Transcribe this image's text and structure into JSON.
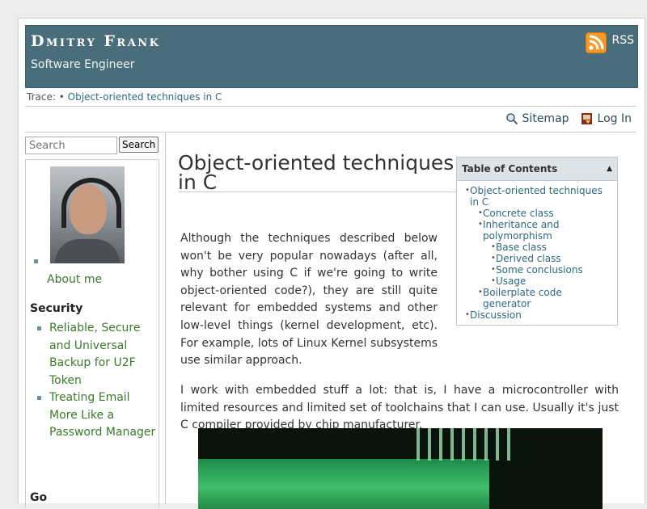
{
  "header": {
    "site_title": "Dmitry Frank",
    "subtitle": "Software Engineer",
    "rss_label": "RSS",
    "rss_icon": "rss-icon"
  },
  "trace": {
    "label": "Trace:",
    "sep": "•",
    "crumb": "Object-oriented techniques in C"
  },
  "tools": {
    "sitemap_label": "Sitemap",
    "sitemap_icon": "sitemap-icon",
    "login_label": "Log In",
    "login_icon": "login-icon"
  },
  "search": {
    "placeholder": "Search",
    "button_label": "Search"
  },
  "sidebar": {
    "about_label": "About me",
    "security_heading": "Security",
    "security_links": [
      "Reliable, Secure and Universal Backup for U2F Token",
      "Treating Email More Like a Password Manager"
    ],
    "go_heading": "Go"
  },
  "article": {
    "title": "Object-oriented techniques in C",
    "paragraph1": "Although the techniques described below won't be very popular nowadays (after all, why bother using C if we're going to write object-oriented code?), they are still quite relevant for embedded systems and other low-level things (kernel development, etc). For example, lots of Linux Kernel subsystems use similar approach.",
    "paragraph2": "I work with embedded stuff a lot: that is, I have a microcontroller with limited resources and limited set of toolchains that I can use. Usually it's just C compiler provided by chip manufacturer."
  },
  "toc": {
    "heading": "Table of Contents",
    "items": [
      "Object-oriented techniques in C",
      "Concrete class",
      "Inheritance and polymorphism",
      "Base class",
      "Derived class",
      "Some conclusions",
      "Usage",
      "Boilerplate code generator",
      "Discussion"
    ]
  },
  "colors": {
    "header_bg": "#4a6d7b",
    "link": "#2c6a80",
    "sidebar_link": "#3b7a2a",
    "rss": "#f39a2a"
  }
}
